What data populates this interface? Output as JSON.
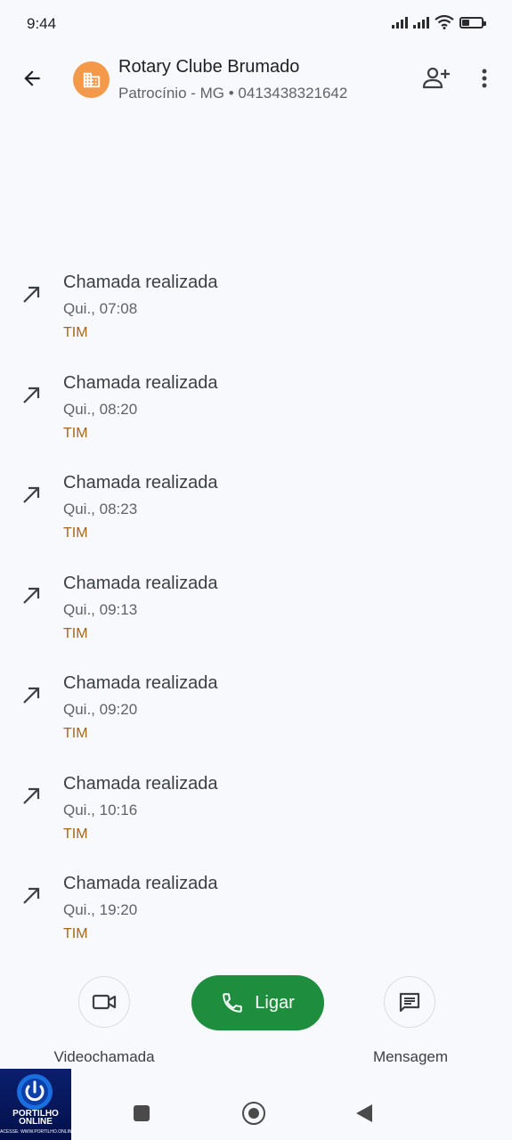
{
  "status_bar": {
    "time": "9:44",
    "battery_level": 0.35,
    "icons": [
      "signal-icon",
      "signal-icon",
      "wifi-icon",
      "battery-icon"
    ]
  },
  "header": {
    "contact_name": "Rotary Clube Brumado",
    "contact_subtitle": "Patrocínio - MG • 0413438321642",
    "avatar_icon": "building-icon",
    "avatar_color": "#f4984a"
  },
  "calls": [
    {
      "title": "Chamada realizada",
      "time": "Qui., 07:08",
      "carrier": "TIM"
    },
    {
      "title": "Chamada realizada",
      "time": "Qui., 08:20",
      "carrier": "TIM"
    },
    {
      "title": "Chamada realizada",
      "time": "Qui., 08:23",
      "carrier": "TIM"
    },
    {
      "title": "Chamada realizada",
      "time": "Qui., 09:13",
      "carrier": "TIM"
    },
    {
      "title": "Chamada realizada",
      "time": "Qui., 09:20",
      "carrier": "TIM"
    },
    {
      "title": "Chamada realizada",
      "time": "Qui., 10:16",
      "carrier": "TIM"
    },
    {
      "title": "Chamada realizada",
      "time": "Qui., 19:20",
      "carrier": "TIM"
    }
  ],
  "actions": {
    "video_label": "Videochamada",
    "call_label": "Ligar",
    "message_label": "Mensagem"
  },
  "colors": {
    "carrier": "#a5661a",
    "call_button": "#1e8e3e",
    "background": "#f8f9fd"
  },
  "watermark": {
    "line1": "PORTILHO",
    "line2": "ONLINE",
    "line3": "ACESSE: WWW.PORTILHO.ONLINE"
  }
}
